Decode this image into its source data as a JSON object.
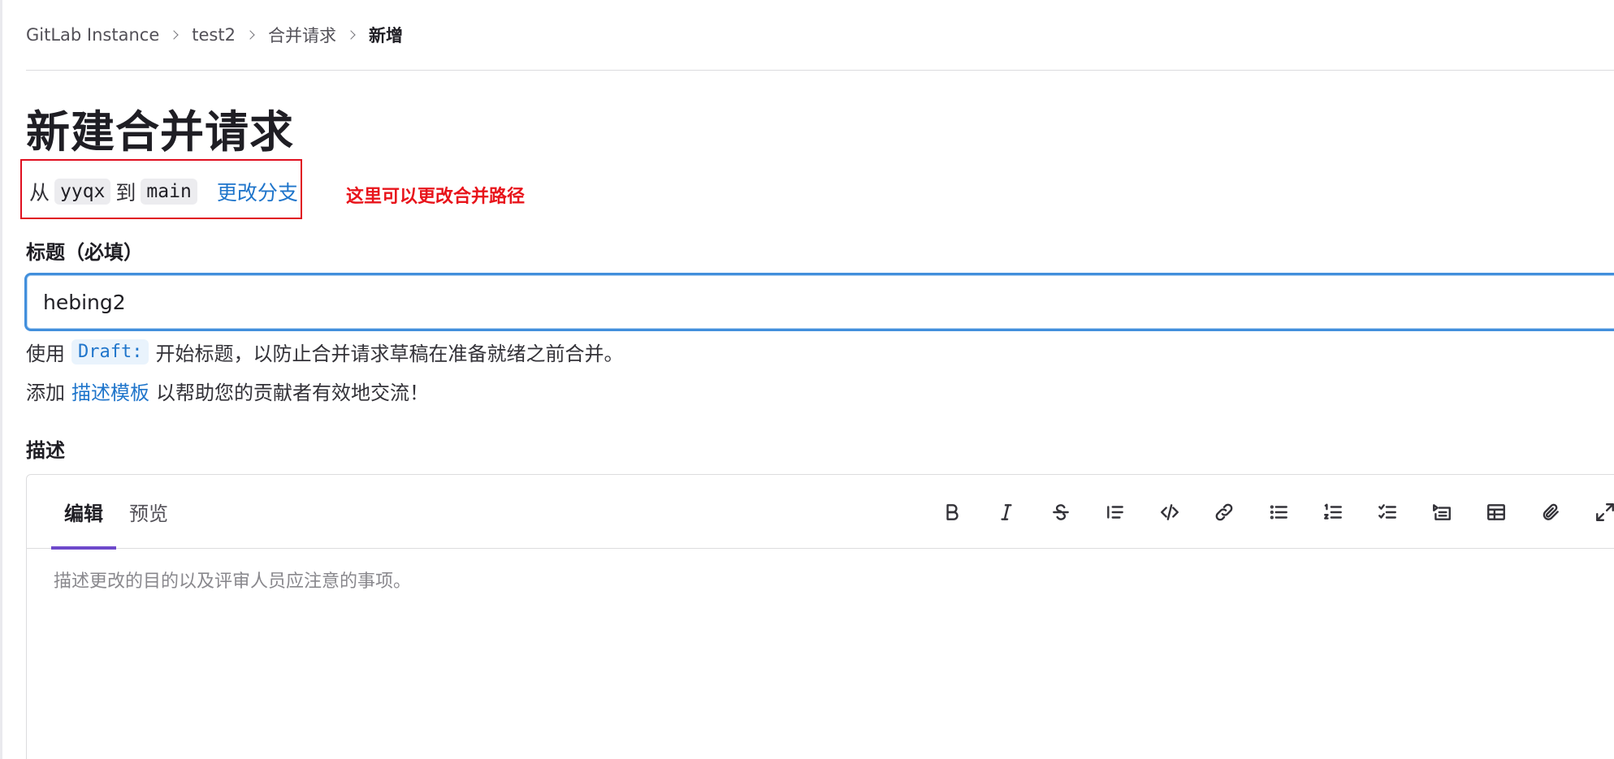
{
  "breadcrumb": {
    "items": [
      "GitLab Instance",
      "test2",
      "合并请求"
    ],
    "current": "新增"
  },
  "page": {
    "title": "新建合并请求"
  },
  "branch": {
    "from_word": "从",
    "source": "yyqx",
    "to_word": "到",
    "target": "main",
    "change_link": "更改分支"
  },
  "annotation": {
    "text": "这里可以更改合并路径",
    "color": "#e8141b"
  },
  "title_field": {
    "label": "标题（必填）",
    "value": "hebing2"
  },
  "help": {
    "draft_prefix": "使用",
    "draft_code": "Draft:",
    "draft_suffix": "开始标题，以防止合并请求草稿在准备就绪之前合并。",
    "template_prefix": "添加",
    "template_link": "描述模板",
    "template_suffix": "以帮助您的贡献者有效地交流！"
  },
  "description": {
    "label": "描述",
    "tabs": [
      "编辑",
      "预览"
    ],
    "active_tab": "编辑",
    "placeholder": "描述更改的目的以及评审人员应注意的事项。",
    "toolbar": [
      "bold-icon",
      "italic-icon",
      "strikethrough-icon",
      "quote-icon",
      "code-icon",
      "link-icon",
      "bullet-list-icon",
      "numbered-list-icon",
      "task-list-icon",
      "collapsible-section-icon",
      "table-icon",
      "attach-file-icon",
      "fullscreen-icon"
    ]
  },
  "colors": {
    "accent_link": "#1f75cb",
    "active_tab_underline": "#6e49cb",
    "input_focus": "#428fdc"
  }
}
